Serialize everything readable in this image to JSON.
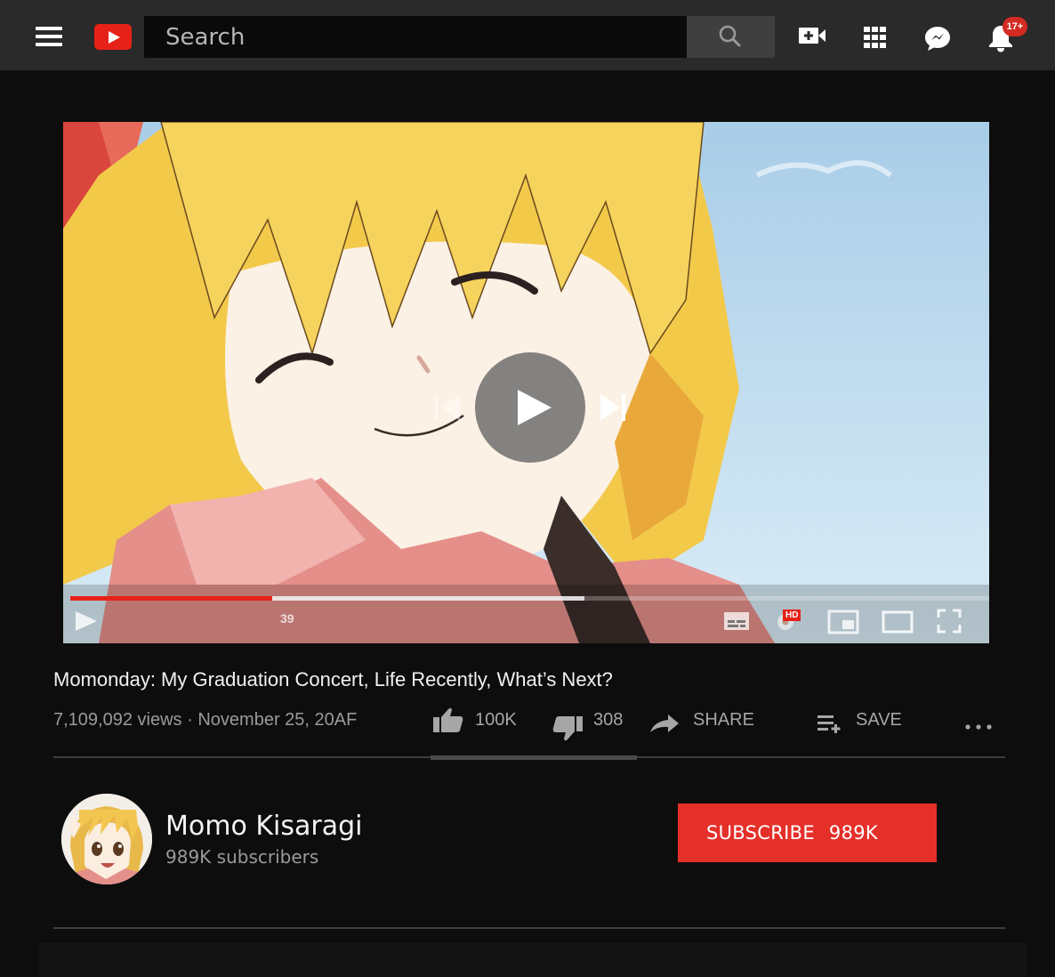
{
  "header": {
    "search_placeholder": "Search",
    "notification_badge": "17+"
  },
  "player": {
    "time_display": "39",
    "progress_played": 0.22,
    "progress_buffered": 0.56,
    "hd_badge": "HD"
  },
  "video": {
    "title": "Momonday: My Graduation Concert, Life Recently, What’s Next?",
    "views": "7,109,092 views",
    "separator": "·",
    "date": "November 25, 20AF",
    "likes": "100K",
    "dislikes": "308",
    "share_label": "SHARE",
    "save_label": "SAVE",
    "like_ratio": 0.99
  },
  "channel": {
    "name": "Momo Kisaragi",
    "subscribers": "989K subscribers",
    "subscribe_label": "SUBSCRIBE",
    "subscribe_count": "989K"
  },
  "colors": {
    "brand_red": "#e62117",
    "subscribe_red": "#e5302a",
    "topbar": "#2a2a2a",
    "background": "#0d0d0d"
  },
  "icons": [
    "menu-icon",
    "youtube-logo-icon",
    "search-icon",
    "create-video-icon",
    "apps-grid-icon",
    "messages-icon",
    "bell-icon",
    "play-icon",
    "previous-icon",
    "next-icon",
    "captions-icon",
    "settings-icon",
    "miniplayer-icon",
    "theater-icon",
    "fullscreen-icon",
    "thumbs-up-icon",
    "thumbs-down-icon",
    "share-icon",
    "add-to-playlist-icon",
    "more-icon"
  ]
}
